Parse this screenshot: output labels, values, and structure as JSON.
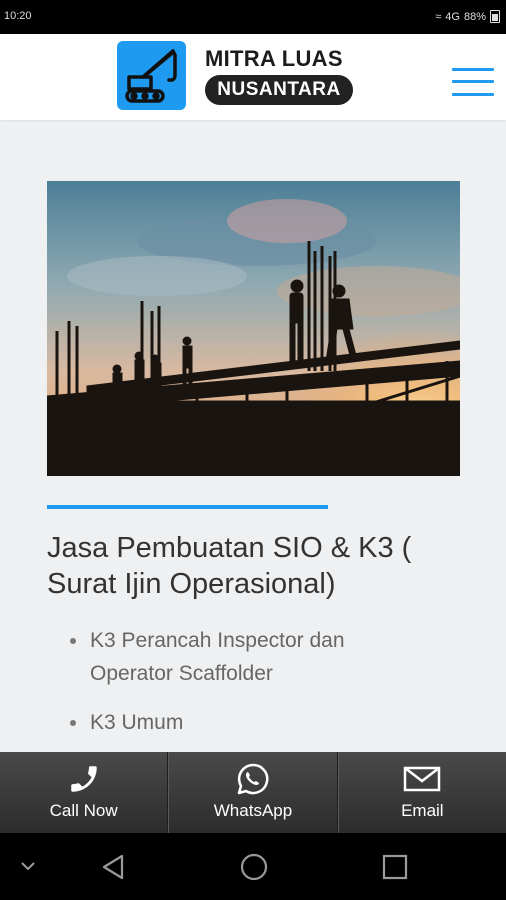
{
  "status_bar": {
    "time": "10:20",
    "signal": "4G",
    "battery": "88%"
  },
  "header": {
    "brand_line1": "MITRA LUAS",
    "brand_line2": "NUSANTARA",
    "logo_icon": "crane-logo-icon",
    "menu_icon": "hamburger-menu-icon"
  },
  "hero": {
    "image": "construction workers silhouette at sunset"
  },
  "article": {
    "title": "Jasa Pembuatan SIO & K3 ( Surat Ijin Operasional)",
    "items": [
      "K3 Perancah Inspector dan Operator Scaffolder",
      "K3 Umum"
    ]
  },
  "cta": [
    {
      "label": "Call Now",
      "icon": "phone-icon"
    },
    {
      "label": "WhatsApp",
      "icon": "whatsapp-icon"
    },
    {
      "label": "Email",
      "icon": "email-icon"
    }
  ],
  "nav": [
    "collapse-icon",
    "back-icon",
    "home-icon",
    "recents-icon"
  ],
  "colors": {
    "accent": "#1e9bf0",
    "dark_bar": "#333333",
    "text": "#333333"
  }
}
